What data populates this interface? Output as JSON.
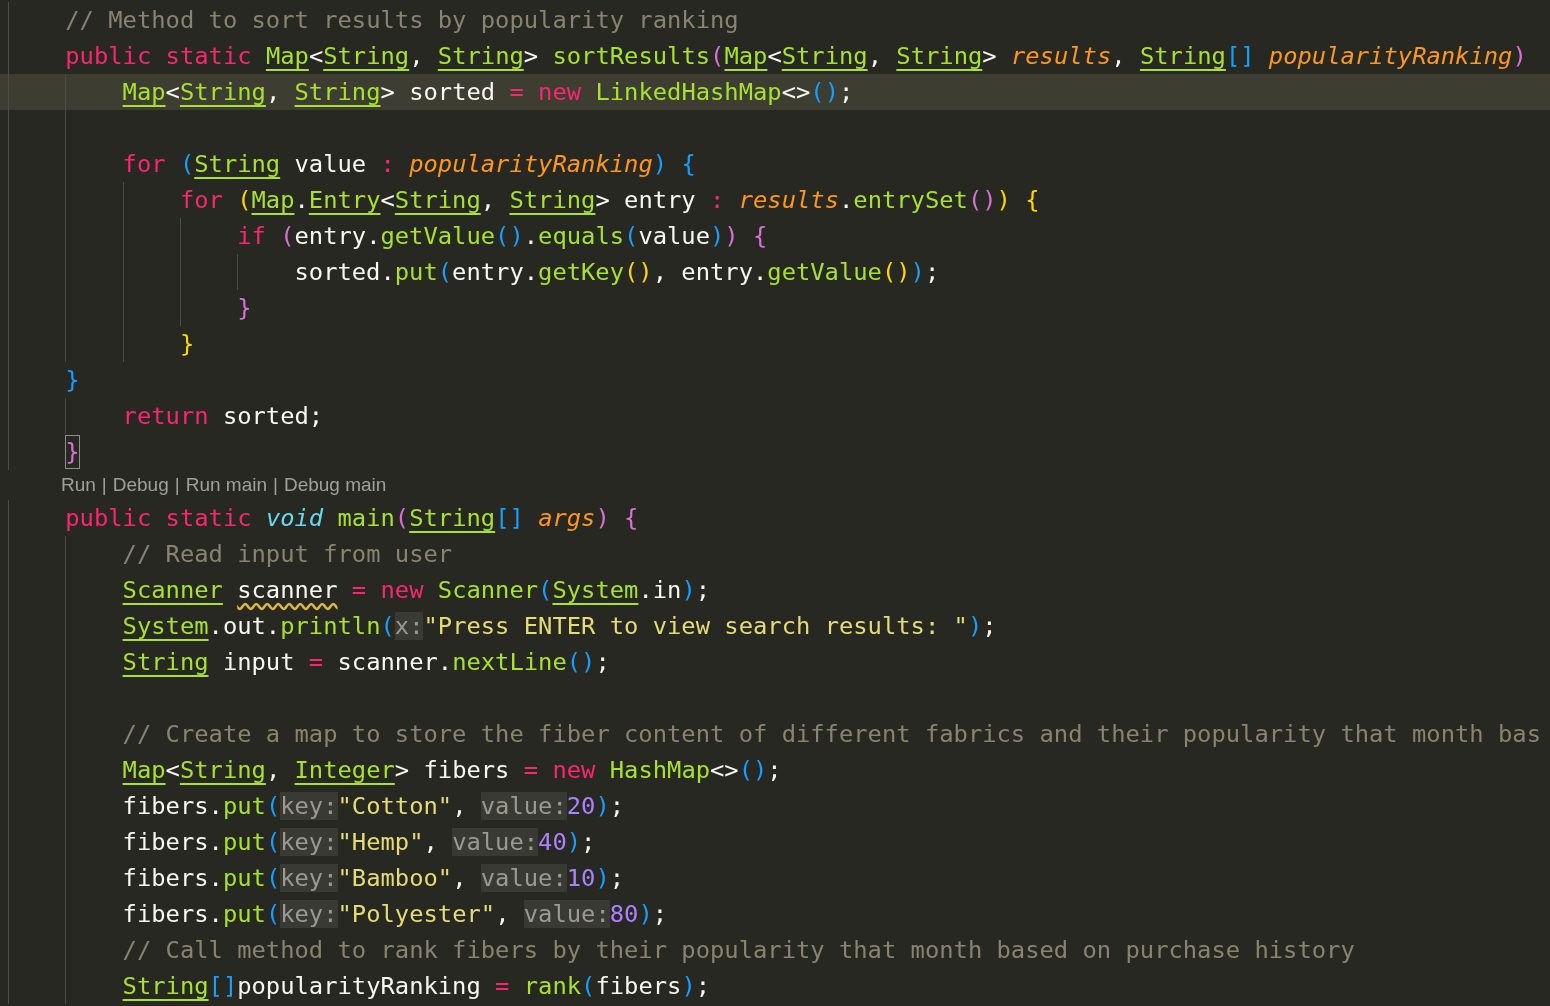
{
  "editor": {
    "lines": [
      {
        "current": false,
        "tokens": [
          {
            "kind": "comment",
            "text": "    // Method to sort results by popularity ranking"
          }
        ]
      },
      {
        "current": false,
        "tokens": [
          {
            "kind": "keyword",
            "text": "    public "
          },
          {
            "kind": "keyword",
            "text": "static "
          },
          {
            "kind": "type",
            "text": "Map"
          },
          {
            "kind": "plain",
            "text": "<"
          },
          {
            "kind": "type",
            "text": "String"
          },
          {
            "kind": "plain",
            "text": ", "
          },
          {
            "kind": "type",
            "text": "String"
          },
          {
            "kind": "plain",
            "text": "> "
          },
          {
            "kind": "function",
            "text": "sortResults"
          },
          {
            "kind": "bracket2",
            "text": "("
          },
          {
            "kind": "type",
            "text": "Map"
          },
          {
            "kind": "plain",
            "text": "<"
          },
          {
            "kind": "type",
            "text": "String"
          },
          {
            "kind": "plain",
            "text": ", "
          },
          {
            "kind": "type",
            "text": "String"
          },
          {
            "kind": "plain",
            "text": "> "
          },
          {
            "kind": "param",
            "text": "results"
          },
          {
            "kind": "plain",
            "text": ", "
          },
          {
            "kind": "type",
            "text": "String"
          },
          {
            "kind": "bracket3",
            "text": "[] "
          },
          {
            "kind": "param",
            "text": "popularityRanking"
          },
          {
            "kind": "bracket2",
            "text": ")"
          }
        ]
      },
      {
        "current": true,
        "tokens": [
          {
            "kind": "type",
            "text": "        Map"
          },
          {
            "kind": "plain",
            "text": "<"
          },
          {
            "kind": "type",
            "text": "String"
          },
          {
            "kind": "plain",
            "text": ", "
          },
          {
            "kind": "type",
            "text": "String"
          },
          {
            "kind": "plain",
            "text": "> sorted "
          },
          {
            "kind": "operator",
            "text": "= "
          },
          {
            "kind": "keyword",
            "text": "new "
          },
          {
            "kind": "function",
            "text": "LinkedHashMap"
          },
          {
            "kind": "plain",
            "text": "<>"
          },
          {
            "kind": "bracket3",
            "text": "()"
          },
          {
            "kind": "plain",
            "text": ";"
          }
        ]
      },
      {
        "current": false
      },
      {
        "current": false,
        "tokens": [
          {
            "kind": "keyword",
            "text": "        for "
          },
          {
            "kind": "bracket3",
            "text": "("
          },
          {
            "kind": "type",
            "text": "String"
          },
          {
            "kind": "plain",
            "text": " value "
          },
          {
            "kind": "operator",
            "text": ": "
          },
          {
            "kind": "param",
            "text": "popularityRanking"
          },
          {
            "kind": "bracket3",
            "text": ") "
          },
          {
            "kind": "bracket3",
            "text": "{"
          }
        ]
      },
      {
        "current": false,
        "tokens": [
          {
            "kind": "keyword",
            "text": "            for "
          },
          {
            "kind": "bracket1",
            "text": "("
          },
          {
            "kind": "type",
            "text": "Map"
          },
          {
            "kind": "plain",
            "text": "."
          },
          {
            "kind": "type",
            "text": "Entry"
          },
          {
            "kind": "plain",
            "text": "<"
          },
          {
            "kind": "type",
            "text": "String"
          },
          {
            "kind": "plain",
            "text": ", "
          },
          {
            "kind": "type",
            "text": "String"
          },
          {
            "kind": "plain",
            "text": "> entry "
          },
          {
            "kind": "operator",
            "text": ": "
          },
          {
            "kind": "param",
            "text": "results"
          },
          {
            "kind": "plain",
            "text": "."
          },
          {
            "kind": "function",
            "text": "entrySet"
          },
          {
            "kind": "bracket2",
            "text": "()"
          },
          {
            "kind": "bracket1",
            "text": ") "
          },
          {
            "kind": "bracket1",
            "text": "{"
          }
        ]
      },
      {
        "current": false,
        "tokens": [
          {
            "kind": "keyword",
            "text": "                if "
          },
          {
            "kind": "bracket2",
            "text": "("
          },
          {
            "kind": "plain",
            "text": "entry."
          },
          {
            "kind": "function",
            "text": "getValue"
          },
          {
            "kind": "bracket3",
            "text": "()"
          },
          {
            "kind": "plain",
            "text": "."
          },
          {
            "kind": "function",
            "text": "equals"
          },
          {
            "kind": "bracket3",
            "text": "("
          },
          {
            "kind": "plain",
            "text": "value"
          },
          {
            "kind": "bracket3",
            "text": ")"
          },
          {
            "kind": "bracket2",
            "text": ") "
          },
          {
            "kind": "bracket2",
            "text": "{"
          }
        ]
      },
      {
        "current": false,
        "tokens": [
          {
            "kind": "plain",
            "text": "                    sorted."
          },
          {
            "kind": "function",
            "text": "put"
          },
          {
            "kind": "bracket3",
            "text": "("
          },
          {
            "kind": "plain",
            "text": "entry."
          },
          {
            "kind": "function",
            "text": "getKey"
          },
          {
            "kind": "bracket1",
            "text": "()"
          },
          {
            "kind": "plain",
            "text": ", entry."
          },
          {
            "kind": "function",
            "text": "getValue"
          },
          {
            "kind": "bracket1",
            "text": "()"
          },
          {
            "kind": "bracket3",
            "text": ")"
          },
          {
            "kind": "plain",
            "text": ";"
          }
        ]
      },
      {
        "current": false,
        "tokens": [
          {
            "kind": "bracket2",
            "text": "                }"
          }
        ]
      },
      {
        "current": false,
        "tokens": [
          {
            "kind": "bracket1",
            "text": "            }"
          }
        ]
      },
      {
        "current": false,
        "tokens": [
          {
            "kind": "bracket3",
            "text": "    }"
          }
        ]
      },
      {
        "current": false,
        "tokens": [
          {
            "kind": "keyword",
            "text": "        return "
          },
          {
            "kind": "plain",
            "text": "sorted;"
          }
        ]
      },
      {
        "current": false,
        "tokens": [
          {
            "kind": "match",
            "text": "    }"
          }
        ]
      },
      {
        "kind": "lens",
        "items": [
          "Run",
          "Debug",
          "Run main",
          "Debug main"
        ],
        "separator": "|"
      },
      {
        "current": false,
        "tokens": [
          {
            "kind": "keyword",
            "text": "    public "
          },
          {
            "kind": "keyword",
            "text": "static "
          },
          {
            "kind": "storage",
            "text": "void "
          },
          {
            "kind": "function",
            "text": "main"
          },
          {
            "kind": "bracket2",
            "text": "("
          },
          {
            "kind": "type",
            "text": "String"
          },
          {
            "kind": "bracket3",
            "text": "[] "
          },
          {
            "kind": "param",
            "text": "args"
          },
          {
            "kind": "bracket2",
            "text": ") "
          },
          {
            "kind": "bracket2",
            "text": "{"
          }
        ]
      },
      {
        "current": false,
        "tokens": [
          {
            "kind": "comment",
            "text": "        // Read input from user"
          }
        ]
      },
      {
        "current": false,
        "tokens": [
          {
            "kind": "type",
            "text": "        Scanner "
          },
          {
            "kind": "warning",
            "text": "scanner "
          },
          {
            "kind": "operator",
            "text": "= "
          },
          {
            "kind": "keyword",
            "text": "new "
          },
          {
            "kind": "function",
            "text": "Scanner"
          },
          {
            "kind": "bracket3",
            "text": "("
          },
          {
            "kind": "type",
            "text": "System"
          },
          {
            "kind": "plain",
            "text": ".in"
          },
          {
            "kind": "bracket3",
            "text": ")"
          },
          {
            "kind": "plain",
            "text": ";"
          }
        ]
      },
      {
        "current": false,
        "tokens": [
          {
            "kind": "type",
            "text": "        System"
          },
          {
            "kind": "plain",
            "text": ".out."
          },
          {
            "kind": "function",
            "text": "println"
          },
          {
            "kind": "bracket3",
            "text": "("
          },
          {
            "kind": "hint",
            "text": "x:"
          },
          {
            "kind": "string",
            "text": "\"Press ENTER to view search results: \""
          },
          {
            "kind": "bracket3",
            "text": ")"
          },
          {
            "kind": "plain",
            "text": ";"
          }
        ]
      },
      {
        "current": false,
        "tokens": [
          {
            "kind": "type",
            "text": "        String"
          },
          {
            "kind": "plain",
            "text": " input "
          },
          {
            "kind": "operator",
            "text": "= "
          },
          {
            "kind": "plain",
            "text": "scanner."
          },
          {
            "kind": "function",
            "text": "nextLine"
          },
          {
            "kind": "bracket3",
            "text": "()"
          },
          {
            "kind": "plain",
            "text": ";"
          }
        ]
      },
      {
        "current": false
      },
      {
        "current": false,
        "tokens": [
          {
            "kind": "comment",
            "text": "        // Create a map to store the fiber content of different fabrics and their popularity that month bas"
          }
        ]
      },
      {
        "current": false,
        "tokens": [
          {
            "kind": "type",
            "text": "        Map"
          },
          {
            "kind": "plain",
            "text": "<"
          },
          {
            "kind": "type",
            "text": "String"
          },
          {
            "kind": "plain",
            "text": ", "
          },
          {
            "kind": "type",
            "text": "Integer"
          },
          {
            "kind": "plain",
            "text": "> fibers "
          },
          {
            "kind": "operator",
            "text": "= "
          },
          {
            "kind": "keyword",
            "text": "new "
          },
          {
            "kind": "function",
            "text": "HashMap"
          },
          {
            "kind": "plain",
            "text": "<>"
          },
          {
            "kind": "bracket3",
            "text": "()"
          },
          {
            "kind": "plain",
            "text": ";"
          }
        ]
      },
      {
        "current": false,
        "tokens": [
          {
            "kind": "plain",
            "text": "        fibers."
          },
          {
            "kind": "function",
            "text": "put"
          },
          {
            "kind": "bracket3",
            "text": "("
          },
          {
            "kind": "hint",
            "text": "key:"
          },
          {
            "kind": "string",
            "text": "\"Cotton\""
          },
          {
            "kind": "plain",
            "text": ", "
          },
          {
            "kind": "hint",
            "text": "value:"
          },
          {
            "kind": "number",
            "text": "20"
          },
          {
            "kind": "bracket3",
            "text": ")"
          },
          {
            "kind": "plain",
            "text": ";"
          }
        ]
      },
      {
        "current": false,
        "tokens": [
          {
            "kind": "plain",
            "text": "        fibers."
          },
          {
            "kind": "function",
            "text": "put"
          },
          {
            "kind": "bracket3",
            "text": "("
          },
          {
            "kind": "hint",
            "text": "key:"
          },
          {
            "kind": "string",
            "text": "\"Hemp\""
          },
          {
            "kind": "plain",
            "text": ", "
          },
          {
            "kind": "hint",
            "text": "value:"
          },
          {
            "kind": "number",
            "text": "40"
          },
          {
            "kind": "bracket3",
            "text": ")"
          },
          {
            "kind": "plain",
            "text": ";"
          }
        ]
      },
      {
        "current": false,
        "tokens": [
          {
            "kind": "plain",
            "text": "        fibers."
          },
          {
            "kind": "function",
            "text": "put"
          },
          {
            "kind": "bracket3",
            "text": "("
          },
          {
            "kind": "hint",
            "text": "key:"
          },
          {
            "kind": "string",
            "text": "\"Bamboo\""
          },
          {
            "kind": "plain",
            "text": ", "
          },
          {
            "kind": "hint",
            "text": "value:"
          },
          {
            "kind": "number",
            "text": "10"
          },
          {
            "kind": "bracket3",
            "text": ")"
          },
          {
            "kind": "plain",
            "text": ";"
          }
        ]
      },
      {
        "current": false,
        "tokens": [
          {
            "kind": "plain",
            "text": "        fibers."
          },
          {
            "kind": "function",
            "text": "put"
          },
          {
            "kind": "bracket3",
            "text": "("
          },
          {
            "kind": "hint",
            "text": "key:"
          },
          {
            "kind": "string",
            "text": "\"Polyester\""
          },
          {
            "kind": "plain",
            "text": ", "
          },
          {
            "kind": "hint",
            "text": "value:"
          },
          {
            "kind": "number",
            "text": "80"
          },
          {
            "kind": "bracket3",
            "text": ")"
          },
          {
            "kind": "plain",
            "text": ";"
          }
        ]
      },
      {
        "current": false,
        "tokens": [
          {
            "kind": "comment",
            "text": "        // Call method to rank fibers by their popularity that month based on purchase history"
          }
        ]
      },
      {
        "current": false,
        "tokens": [
          {
            "kind": "type",
            "text": "        String"
          },
          {
            "kind": "bracket3",
            "text": "[]"
          },
          {
            "kind": "plain",
            "text": "popularityRanking "
          },
          {
            "kind": "operator",
            "text": "= "
          },
          {
            "kind": "function",
            "text": "rank"
          },
          {
            "kind": "bracket3",
            "text": "("
          },
          {
            "kind": "plain",
            "text": "fibers"
          },
          {
            "kind": "bracket3",
            "text": ")"
          },
          {
            "kind": "plain",
            "text": ";"
          }
        ]
      }
    ]
  }
}
